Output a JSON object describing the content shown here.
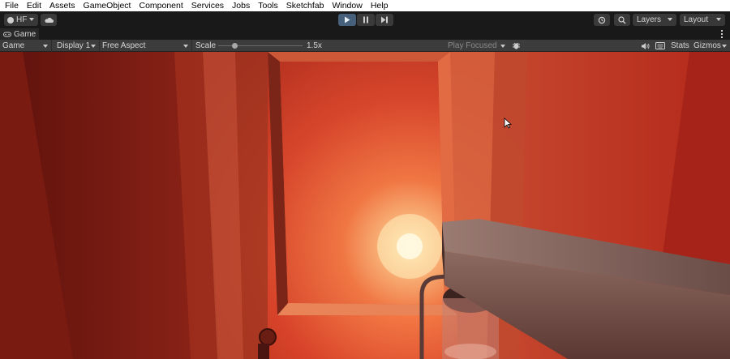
{
  "menu": {
    "items": [
      "File",
      "Edit",
      "Assets",
      "GameObject",
      "Component",
      "Services",
      "Jobs",
      "Tools",
      "Sketchfab",
      "Window",
      "Help"
    ]
  },
  "toolbar": {
    "account_label": "HF",
    "layers_label": "Layers",
    "layout_label": "Layout"
  },
  "tab": {
    "title": "Game"
  },
  "controls": {
    "view_mode": "Game",
    "display": "Display 1",
    "aspect": "Free Aspect",
    "scale_label": "Scale",
    "scale_value": "1.5x",
    "scale_level": 0.2,
    "play_mode": "Play Focused",
    "stats_label": "Stats",
    "gizmos_label": "Gizmos"
  },
  "colors": {
    "play_active": "#46607c",
    "scene_glow": "#ffd28a",
    "scene_red": "#b3281a"
  }
}
